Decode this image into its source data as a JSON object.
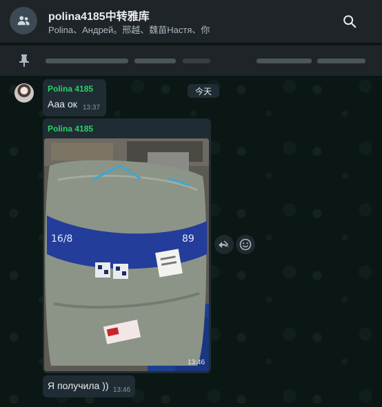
{
  "header": {
    "title": "polina4185中转雅库",
    "subtitle": "Polina、Андрей。邢越、魏苗Настя、你"
  },
  "pinned": {
    "icon": "pin-icon"
  },
  "date_chip": "今天",
  "messages": [
    {
      "sender": "Polina 4185",
      "text": "Ааа ок",
      "time": "13:37"
    },
    {
      "sender": "Polina 4185",
      "type": "photo",
      "time": "13:46"
    },
    {
      "text": "Я получила ))",
      "time": "13:46"
    }
  ],
  "colors": {
    "header_bg": "#1e2427",
    "bubble_bg": "#202c33",
    "sender_name": "#25d366",
    "text": "#e9edef",
    "meta": "#8696a0"
  }
}
